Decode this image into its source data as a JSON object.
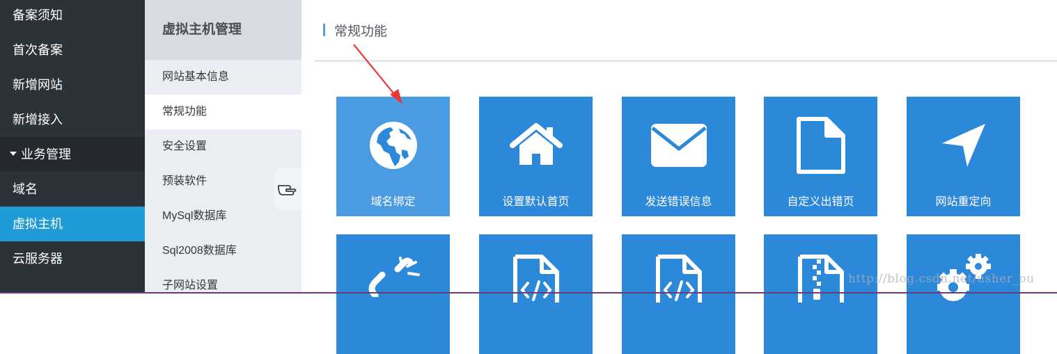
{
  "left_nav": {
    "items": [
      {
        "label": "备案须知",
        "type": "item"
      },
      {
        "label": "首次备案",
        "type": "item"
      },
      {
        "label": "新增网站",
        "type": "item"
      },
      {
        "label": "新增接入",
        "type": "item"
      },
      {
        "label": "业务管理",
        "type": "section"
      },
      {
        "label": "域名",
        "type": "item"
      },
      {
        "label": "虚拟主机",
        "type": "active"
      },
      {
        "label": "云服务器",
        "type": "item"
      }
    ]
  },
  "sub_nav": {
    "title": "虚拟主机管理",
    "links": [
      {
        "label": "网站基本信息"
      },
      {
        "label": "常规功能",
        "active": true
      },
      {
        "label": "安全设置"
      },
      {
        "label": "预装软件"
      },
      {
        "label": "MySql数据库"
      },
      {
        "label": "Sql2008数据库"
      },
      {
        "label": "子网站设置"
      }
    ],
    "handle_icon": "pointing-hand-icon"
  },
  "main": {
    "section_title": "常规功能",
    "tiles_row1": [
      {
        "label": "域名绑定",
        "icon": "globe-icon"
      },
      {
        "label": "设置默认首页",
        "icon": "home-icon"
      },
      {
        "label": "发送错误信息",
        "icon": "envelope-icon"
      },
      {
        "label": "自定义出错页",
        "icon": "file-icon"
      },
      {
        "label": "网站重定向",
        "icon": "location-arrow-icon"
      }
    ],
    "tiles_row2": [
      {
        "icon": "unlink-icon"
      },
      {
        "icon": "file-code-icon"
      },
      {
        "icon": "file-code-icon"
      },
      {
        "icon": "file-zip-icon"
      },
      {
        "icon": "cogs-icon"
      }
    ]
  },
  "colors": {
    "tile": "#2c88d9",
    "tile_highlight": "#4b9be3",
    "nav_active": "#1f9bd5",
    "annotation_arrow": "#e8383d"
  },
  "watermark": "http://blog.csdn.net/usher_ou"
}
